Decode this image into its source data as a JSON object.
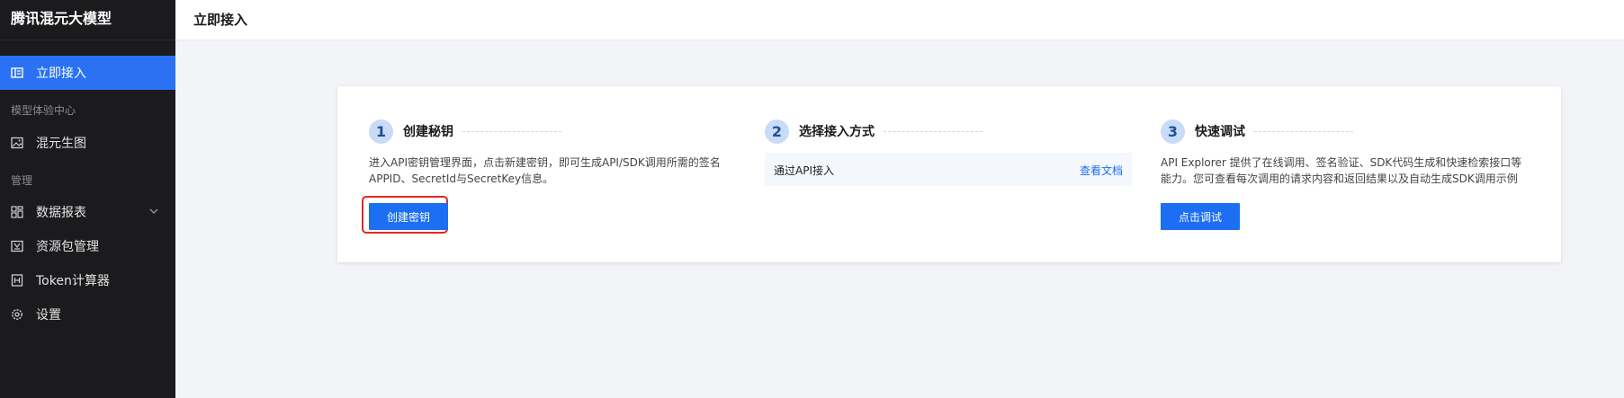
{
  "sidebar": {
    "brand": "腾讯混元大模型",
    "items": [
      {
        "label": "立即接入",
        "icon": "book-icon",
        "active": true
      },
      {
        "label": "混元生图",
        "icon": "image-icon"
      },
      {
        "label": "数据报表",
        "icon": "dashboard-icon"
      },
      {
        "label": "资源包管理",
        "icon": "package-icon"
      },
      {
        "label": "Token计算器",
        "icon": "calculator-icon"
      },
      {
        "label": "设置",
        "icon": "gear-icon"
      }
    ],
    "sections": [
      "模型体验中心",
      "管理"
    ]
  },
  "header": {
    "title": "立即接入"
  },
  "steps": [
    {
      "number": "1",
      "title": "创建秘钥",
      "desc_line1": "进入API密钥管理界面，点击新建密钥，即可生成API/SDK调用所需的签名",
      "desc_line2": "APPID、SecretId与SecretKey信息。",
      "button": "创建密钥"
    },
    {
      "number": "2",
      "title": "选择接入方式",
      "method_label": "通过API接入",
      "method_link": "查看文档"
    },
    {
      "number": "3",
      "title": "快速调试",
      "desc_line1": "API Explorer 提供了在线调用、签名验证、SDK代码生成和快速检索接口等",
      "desc_line2": "能力。您可查看每次调用的请求内容和返回结果以及自动生成SDK调用示例",
      "button": "点击调试"
    }
  ],
  "colors": {
    "accent": "#1c6ef2",
    "sidebar_bg": "#1b1b1e",
    "active_bg": "#2a72f3",
    "highlight": "#e8262a"
  }
}
